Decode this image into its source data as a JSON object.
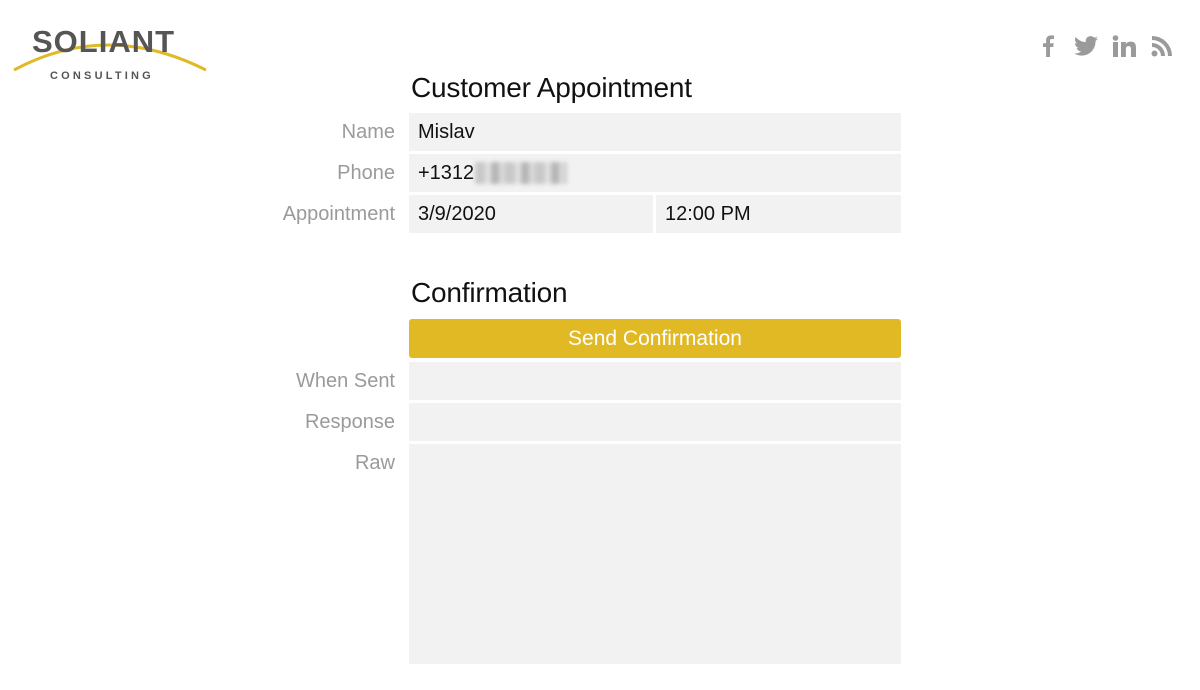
{
  "brand": {
    "logo_word": "SOLIANT",
    "logo_sub": "CONSULTING",
    "accent_color": "#e1b925"
  },
  "social": [
    {
      "icon": "facebook-icon"
    },
    {
      "icon": "twitter-icon"
    },
    {
      "icon": "linkedin-icon"
    },
    {
      "icon": "rss-icon"
    }
  ],
  "appointment": {
    "title": "Customer Appointment",
    "name_label": "Name",
    "name_value": "Mislav",
    "phone_label": "Phone",
    "phone_value": "+1312",
    "appointment_label": "Appointment",
    "date_value": "3/9/2020",
    "time_value": "12:00 PM"
  },
  "confirmation": {
    "title": "Confirmation",
    "send_button": "Send Confirmation",
    "when_sent_label": "When Sent",
    "when_sent_value": "",
    "response_label": "Response",
    "response_value": "",
    "raw_label": "Raw",
    "raw_value": ""
  }
}
